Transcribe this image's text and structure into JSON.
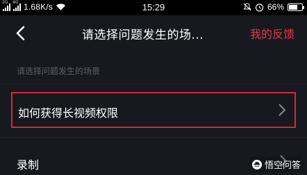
{
  "status_bar": {
    "network_type": "2G",
    "network_type_2": "4G",
    "speed": "1.68K/s",
    "time": "15:29",
    "battery": "66%",
    "battery_level": 0.66,
    "icons": [
      "signal-icon",
      "wifi-icon",
      "mute-icon",
      "alarm-icon",
      "battery-icon"
    ]
  },
  "header": {
    "title": "请选择问题发生的场...",
    "feedback_label": "我的反馈"
  },
  "section": {
    "hint": "请选择问题发生的场景"
  },
  "list": {
    "items": [
      {
        "label": "如何获得长视频权限",
        "highlighted": true
      },
      {
        "label": "录制",
        "highlighted": false
      }
    ]
  },
  "colors": {
    "background": "#17191f",
    "accent": "#e4374e",
    "highlight_border": "#d9283c",
    "hint_text": "#5e6069"
  },
  "watermark": {
    "text": "悟空问答"
  }
}
